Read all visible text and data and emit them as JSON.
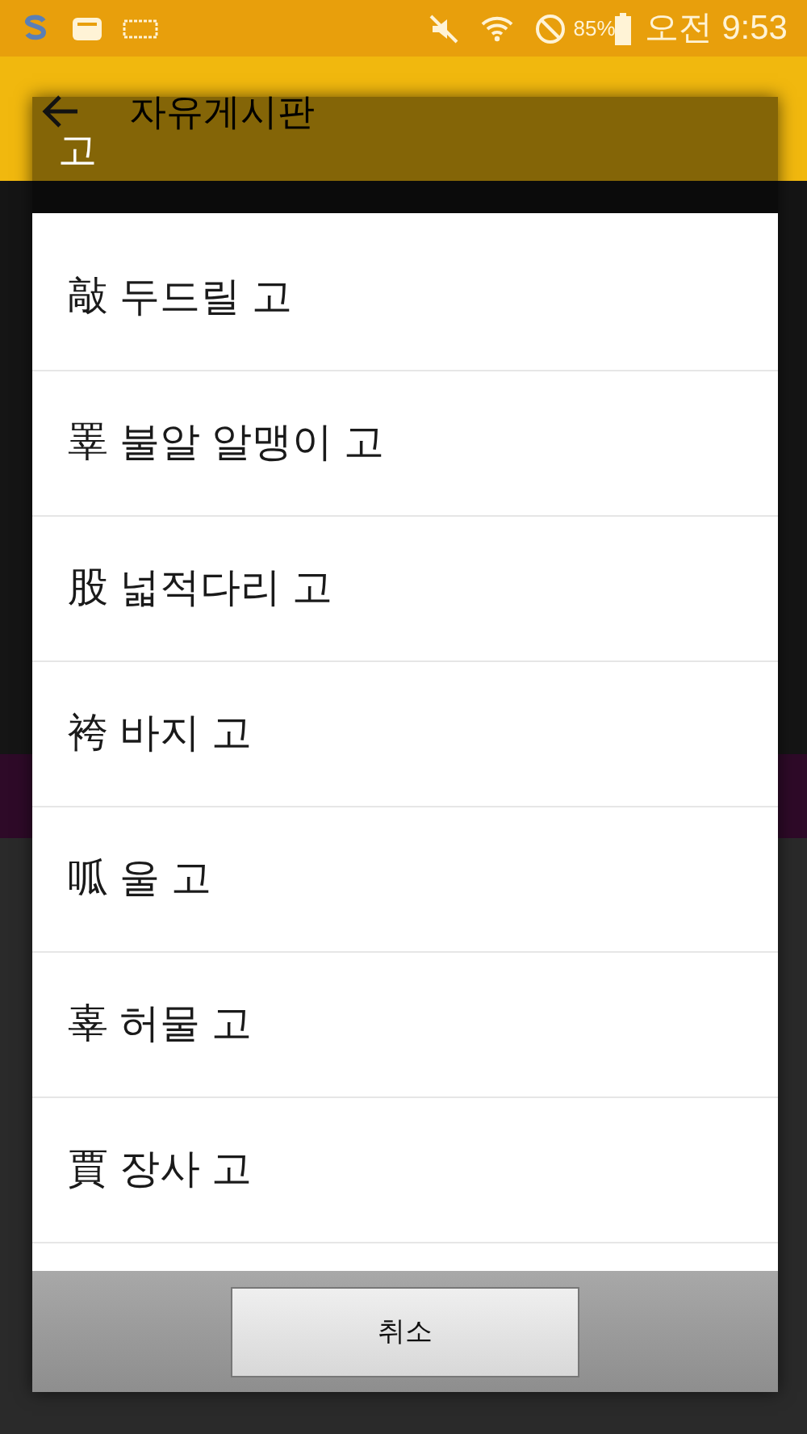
{
  "status_bar": {
    "battery": "85%",
    "time": "오전 9:53"
  },
  "app_bar": {
    "title": "자유게시판"
  },
  "dialog": {
    "title": "고",
    "items": [
      {
        "label": "敲 두드릴 고"
      },
      {
        "label": "睪 불알 알맹이 고"
      },
      {
        "label": "股 넓적다리 고"
      },
      {
        "label": "袴 바지 고"
      },
      {
        "label": "呱 울 고"
      },
      {
        "label": "辜 허물 고"
      },
      {
        "label": "賈 장사 고"
      }
    ],
    "cancel_button": "취소"
  }
}
